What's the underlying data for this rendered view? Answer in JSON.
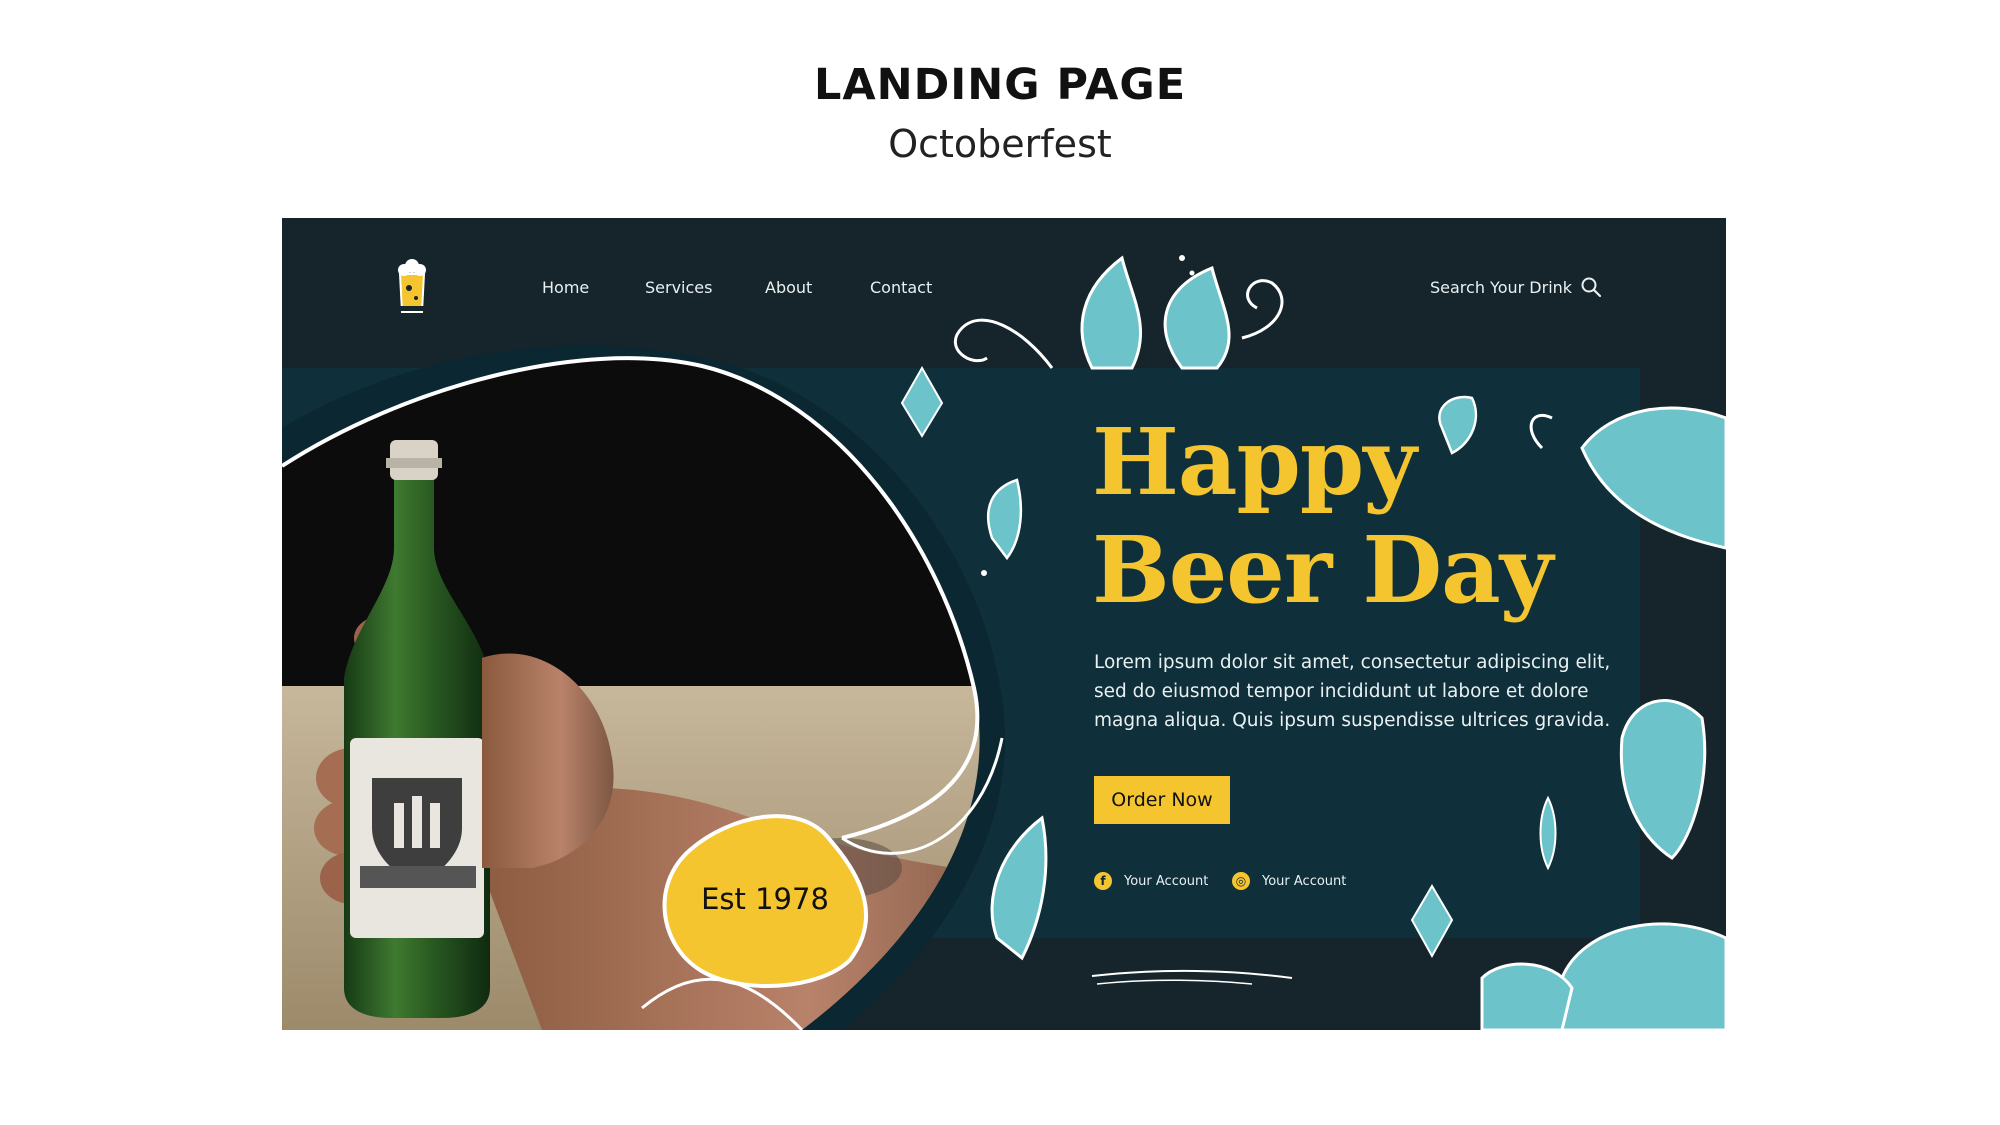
{
  "header": {
    "title": "LANDING PAGE",
    "subtitle": "Octoberfest"
  },
  "nav": {
    "items": [
      {
        "label": "Home"
      },
      {
        "label": "Services"
      },
      {
        "label": "About"
      },
      {
        "label": "Contact"
      }
    ]
  },
  "search": {
    "label": "Search Your Drink",
    "icon": "search-icon"
  },
  "hero": {
    "title_line1": "Happy",
    "title_line2": "Beer Day",
    "description": "Lorem ipsum dolor sit amet, consectetur adipiscing elit, sed do eiusmod tempor incididunt ut labore et dolore magna aliqua. Quis ipsum suspendisse ultrices gravida.",
    "cta_label": "Order Now",
    "badge_text": "Est 1978"
  },
  "social": {
    "items": [
      {
        "icon": "facebook-icon",
        "label": "Your Account"
      },
      {
        "icon": "instagram-icon",
        "label": "Your Account"
      }
    ]
  },
  "colors": {
    "background_dark": "#15252b",
    "panel": "#0f2f3a",
    "accent_yellow": "#f5c530",
    "leaf_teal": "#6cc3c9",
    "text_light": "#e8f0f2"
  }
}
